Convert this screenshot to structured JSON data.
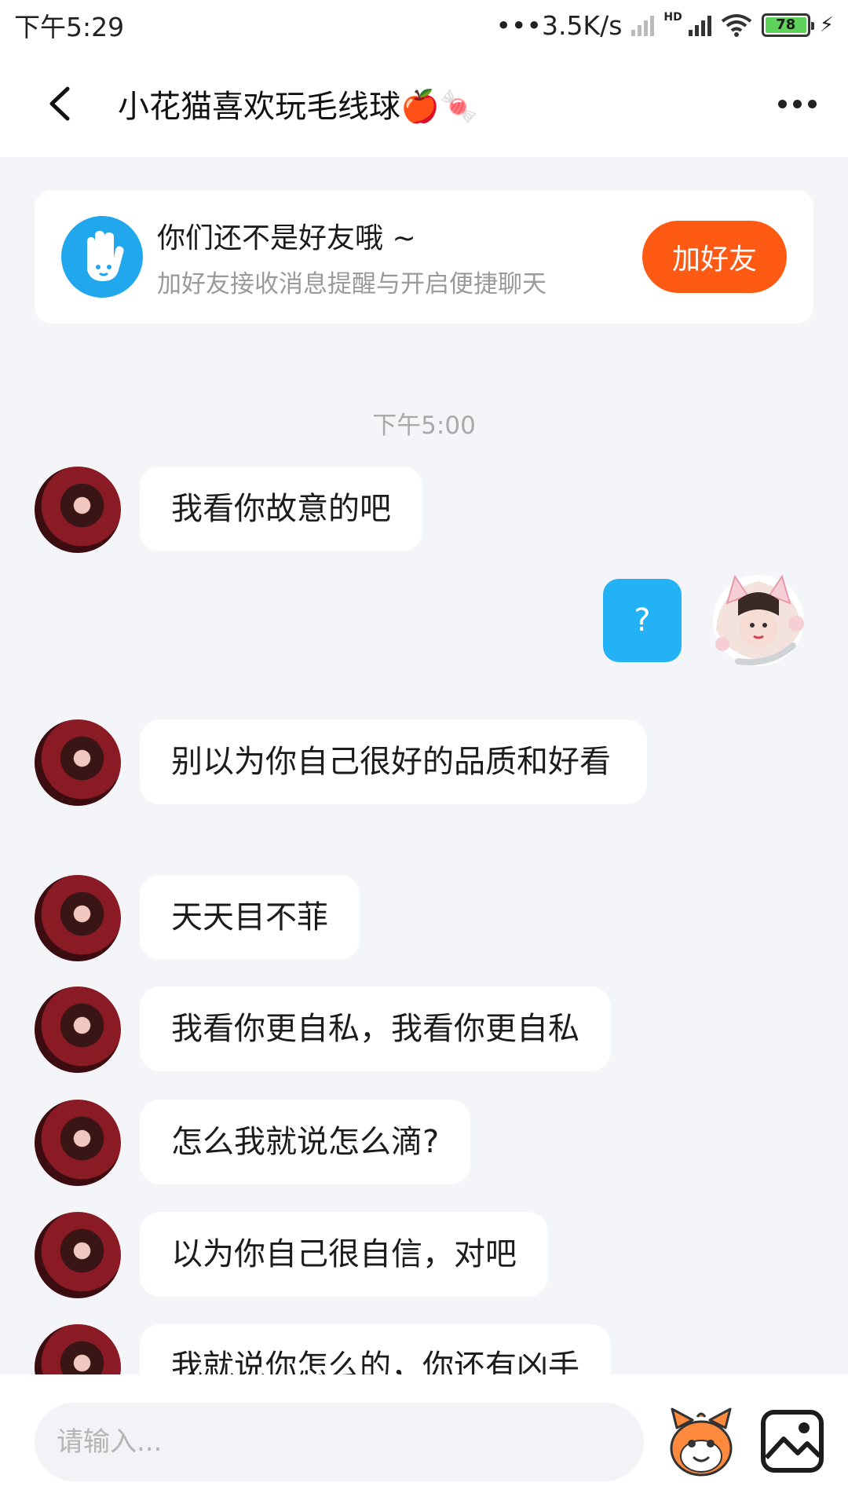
{
  "status": {
    "time": "下午5:29",
    "network_speed": "3.5K/s",
    "battery": "78"
  },
  "header": {
    "title": "小花猫喜欢玩毛线球🍎🍬"
  },
  "friend_card": {
    "title": "你们还不是好友哦 ~",
    "subtitle": "加好友接收消息提醒与开启便捷聊天",
    "button_label": "加好友"
  },
  "chat": {
    "timestamp": "下午5:00",
    "messages": [
      {
        "side": "left",
        "text": "我看你故意的吧"
      },
      {
        "side": "right",
        "text": "?"
      },
      {
        "side": "left",
        "text": "别以为你自己很好的品质和好看"
      },
      {
        "side": "left",
        "text": "天天目不菲"
      },
      {
        "side": "left",
        "text": "我看你更自私，我看你更自私"
      },
      {
        "side": "left",
        "text": "怎么我就说怎么滴?"
      },
      {
        "side": "left",
        "text": "以为你自己很自信，对吧"
      },
      {
        "side": "left",
        "text": "我就说你怎么的，你还有凶手"
      }
    ]
  },
  "input": {
    "placeholder": "请输入..."
  },
  "colors": {
    "accent_blue": "#23b2f5",
    "add_friend_orange": "#ff5a14",
    "background": "#f4f5f9"
  }
}
